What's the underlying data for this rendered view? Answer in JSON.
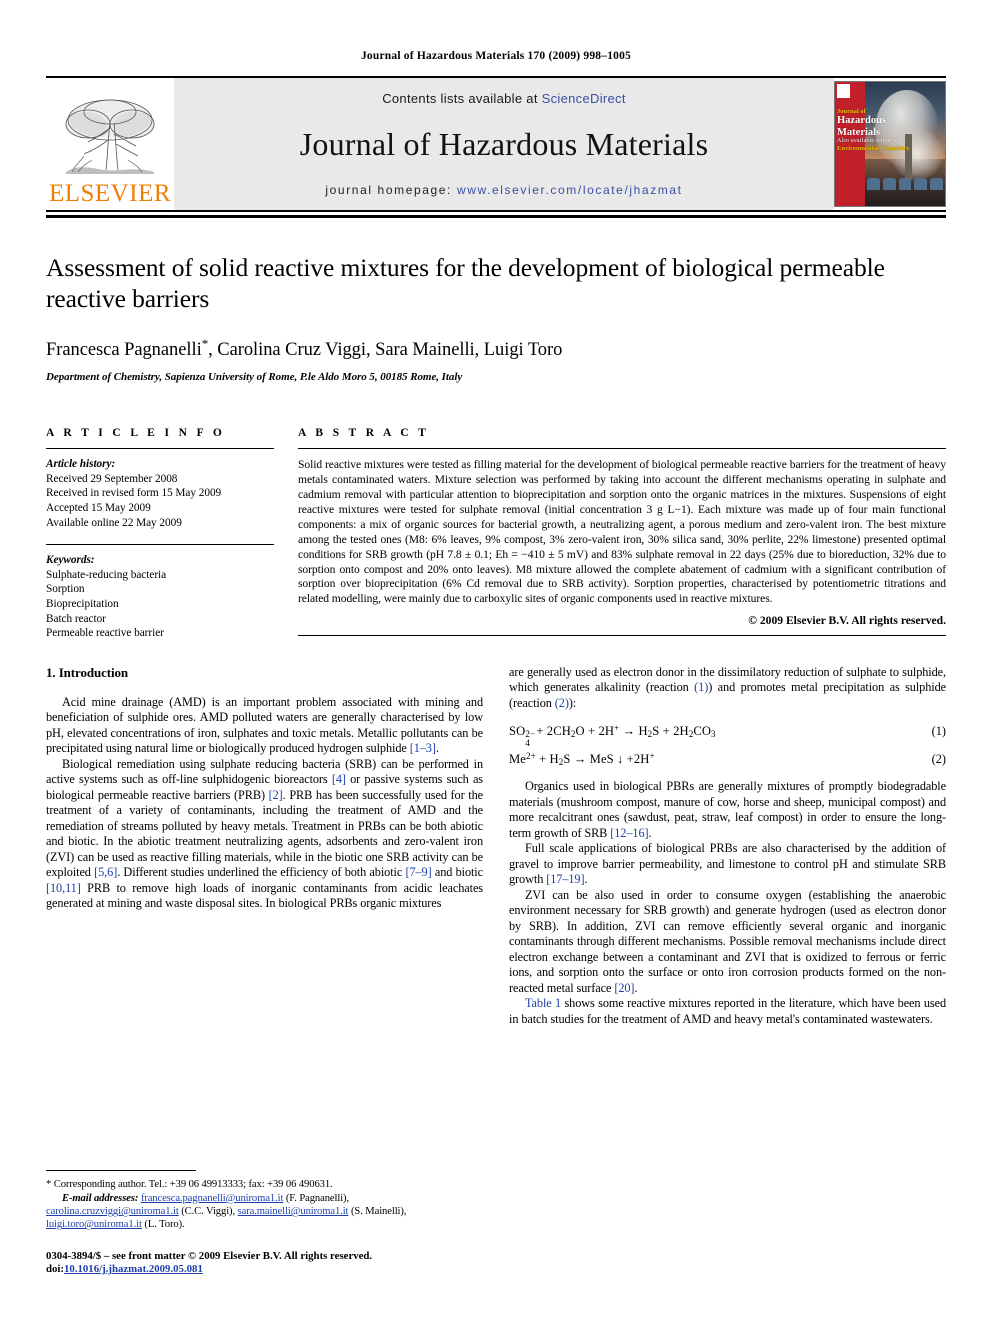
{
  "running_head": "Journal of Hazardous Materials 170 (2009) 998–1005",
  "masthead": {
    "publisher_name": "ELSEVIER",
    "contents_prefix": "Contents lists available at",
    "contents_link": "ScienceDirect",
    "journal_title": "Journal of Hazardous Materials",
    "homepage_prefix": "journal homepage:",
    "homepage_url": "www.elsevier.com/locate/jhazmat",
    "cover": {
      "line1": "Journal of",
      "line2": "Hazardous",
      "line3": "Materials",
      "line4": "Also available online at",
      "line5": "Environmental Chemistry"
    },
    "colors": {
      "link_blue": "#3b4fa0",
      "elsevier_orange": "#EE7F00",
      "masthead_grey": "#e9e9e9",
      "cover_red": "#c0202a"
    }
  },
  "article": {
    "title": "Assessment of solid reactive mixtures for the development of biological permeable reactive barriers",
    "authors": "Francesca Pagnanelli*, Carolina Cruz Viggi, Sara Mainelli, Luigi Toro",
    "authors_plain": "Francesca Pagnanelli",
    "authors_rest": ", Carolina Cruz Viggi, Sara Mainelli, Luigi Toro",
    "affiliation": "Department of Chemistry, Sapienza University of Rome, P.le Aldo Moro 5, 00185 Rome, Italy"
  },
  "article_info": {
    "heading": "A R T I C L E    I N F O",
    "history_label": "Article history:",
    "history": [
      "Received 29 September 2008",
      "Received in revised form 15 May 2009",
      "Accepted 15 May 2009",
      "Available online 22 May 2009"
    ],
    "keywords_label": "Keywords:",
    "keywords": [
      "Sulphate-reducing bacteria",
      "Sorption",
      "Bioprecipitation",
      "Batch reactor",
      "Permeable reactive barrier"
    ]
  },
  "abstract": {
    "heading": "A B S T R A C T",
    "text": "Solid reactive mixtures were tested as filling material for the development of biological permeable reactive barriers for the treatment of heavy metals contaminated waters. Mixture selection was performed by taking into account the different mechanisms operating in sulphate and cadmium removal with particular attention to bioprecipitation and sorption onto the organic matrices in the mixtures. Suspensions of eight reactive mixtures were tested for sulphate removal (initial concentration 3 g L−1). Each mixture was made up of four main functional components: a mix of organic sources for bacterial growth, a neutralizing agent, a porous medium and zero-valent iron. The best mixture among the tested ones (M8: 6% leaves, 9% compost, 3% zero-valent iron, 30% silica sand, 30% perlite, 22% limestone) presented optimal conditions for SRB growth (pH 7.8 ± 0.1; Eh = −410 ± 5 mV) and 83% sulphate removal in 22 days (25% due to bioreduction, 32% due to sorption onto compost and 20% onto leaves). M8 mixture allowed the complete abatement of cadmium with a significant contribution of sorption over bioprecipitation (6% Cd removal due to SRB activity). Sorption properties, characterised by potentiometric titrations and related modelling, were mainly due to carboxylic sites of organic components used in reactive mixtures.",
    "copyright": "© 2009 Elsevier B.V. All rights reserved."
  },
  "body": {
    "section_number_title": "1.  Introduction",
    "left_paragraphs": [
      "Acid mine drainage (AMD) is an important problem associated with mining and beneficiation of sulphide ores. AMD polluted waters are generally characterised by low pH, elevated concentrations of iron, sulphates and toxic metals. Metallic pollutants can be precipitated using natural lime or biologically produced hydrogen sulphide [1–3].",
      "Biological remediation using sulphate reducing bacteria (SRB) can be performed in active systems such as off-line sulphidogenic bioreactors [4] or passive systems such as biological permeable reactive barriers (PRB) [2]. PRB has been successfully used for the treatment of a variety of contaminants, including the treatment of AMD and the remediation of streams polluted by heavy metals. Treatment in PRBs can be both abiotic and biotic. In the abiotic treatment neutralizing agents, adsorbents and zero-valent iron (ZVI) can be used as reactive filling materials, while in the biotic one SRB activity can be exploited [5,6]. Different studies underlined the efficiency of both abiotic [7–9] and biotic [10,11] PRB to remove high loads of inorganic contaminants from acidic leachates generated at mining and waste disposal sites. In biological PRBs organic mixtures"
    ],
    "right_intro": "are generally used as electron donor in the dissimilatory reduction of sulphate to sulphide, which generates alkalinity (reaction (1)) and promotes metal precipitation as sulphide (reaction (2)):",
    "equations": [
      {
        "text": "SO4^2− + 2CH2O + 2H+ → H2S + 2H2CO3",
        "number": "(1)"
      },
      {
        "text": "Me2+ + H2S → MeS ↓ +2H+",
        "number": "(2)"
      }
    ],
    "right_paragraphs": [
      "Organics used in biological PBRs are generally mixtures of promptly biodegradable materials (mushroom compost, manure of cow, horse and sheep, municipal compost) and more recalcitrant ones (sawdust, peat, straw, leaf compost) in order to ensure the long-term growth of SRB [12–16].",
      "Full scale applications of biological PRBs are also characterised by the addition of gravel to improve barrier permeability, and limestone to control pH and stimulate SRB growth [17–19].",
      "ZVI can be also used in order to consume oxygen (establishing the anaerobic environment necessary for SRB growth) and generate hydrogen (used as electron donor by SRB). In addition, ZVI can remove efficiently several organic and inorganic contaminants through different mechanisms. Possible removal mechanisms include direct electron exchange between a contaminant and ZVI that is oxidized to ferrous or ferric ions, and sorption onto the surface or onto iron corrosion products formed on the non-reacted metal surface [20].",
      "Table 1 shows some reactive mixtures reported in the literature, which have been used in batch studies for the treatment of AMD and heavy metal's contaminated wastewaters."
    ]
  },
  "footnotes": {
    "corresponding": "*  Corresponding author. Tel.: +39 06 49913333; fax: +39 06 490631.",
    "email_label": "E-mail addresses:",
    "emails": [
      {
        "address": "francesca.pagnanelli@uniroma1.it",
        "owner": "(F. Pagnanelli),"
      },
      {
        "address": "carolina.cruzviggi@uniroma1.it",
        "owner": "(C.C. Viggi),"
      },
      {
        "address": "sara.mainelli@uniroma1.it",
        "owner": "(S. Mainelli),"
      },
      {
        "address": "luigi.toro@uniroma1.it",
        "owner": "(L. Toro)."
      }
    ],
    "issn_line": "0304-3894/$ – see front matter © 2009 Elsevier B.V. All rights reserved.",
    "doi_label": "doi:",
    "doi_value": "10.1016/j.jhazmat.2009.05.081"
  }
}
